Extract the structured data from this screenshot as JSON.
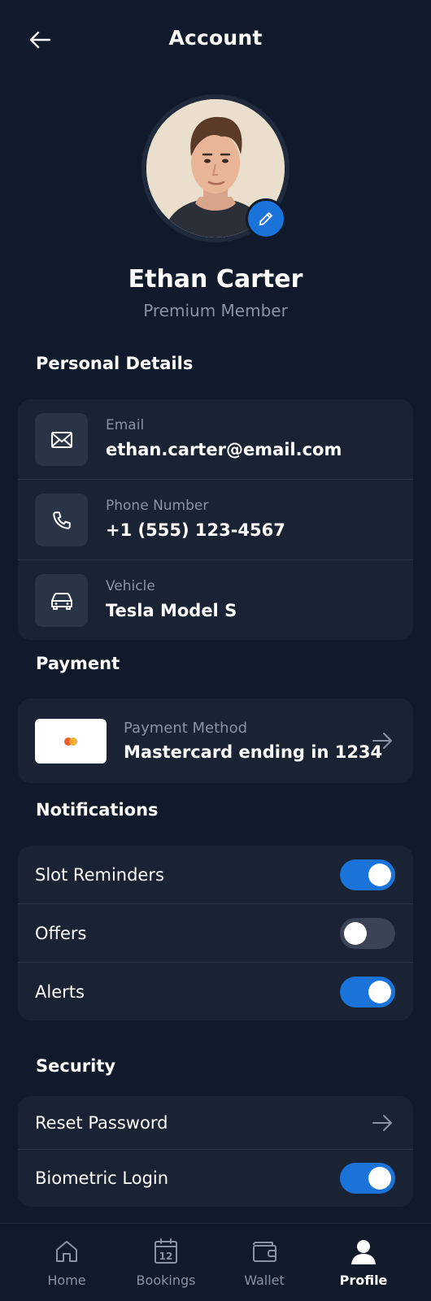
{
  "header": {
    "title": "Account",
    "back_icon": "arrow-left-icon"
  },
  "profile": {
    "name": "Ethan Carter",
    "tier": "Premium Member",
    "edit_icon": "pencil-icon"
  },
  "personal_details": {
    "title": "Personal Details",
    "items": [
      {
        "label": "Email",
        "value": "ethan.carter@email.com",
        "icon": "mail-icon"
      },
      {
        "label": "Phone Number",
        "value": "+1 (555) 123-4567",
        "icon": "phone-icon"
      },
      {
        "label": "Vehicle",
        "value": "Tesla Model S",
        "icon": "car-icon"
      }
    ]
  },
  "payment": {
    "title": "Payment",
    "label": "Payment Method",
    "value": "Mastercard ending in 1234",
    "icon": "mastercard-icon"
  },
  "notifications": {
    "title": "Notifications",
    "items": [
      {
        "label": "Slot Reminders",
        "enabled": true
      },
      {
        "label": "Offers",
        "enabled": false
      },
      {
        "label": "Alerts",
        "enabled": true
      }
    ]
  },
  "security": {
    "title": "Security",
    "reset_password": "Reset Password",
    "biometric_login": "Biometric Login",
    "biometric_enabled": true
  },
  "bottom_nav": {
    "items": [
      {
        "label": "Home",
        "icon": "home-icon",
        "active": false
      },
      {
        "label": "Bookings",
        "icon": "calendar-icon",
        "calendar_day": "12",
        "active": false
      },
      {
        "label": "Wallet",
        "icon": "wallet-icon",
        "active": false
      },
      {
        "label": "Profile",
        "icon": "user-icon",
        "active": true
      }
    ]
  },
  "colors": {
    "background": "#111a2b",
    "card": "#1a2334",
    "accent": "#1a73d9",
    "muted_text": "#8a93a6"
  }
}
